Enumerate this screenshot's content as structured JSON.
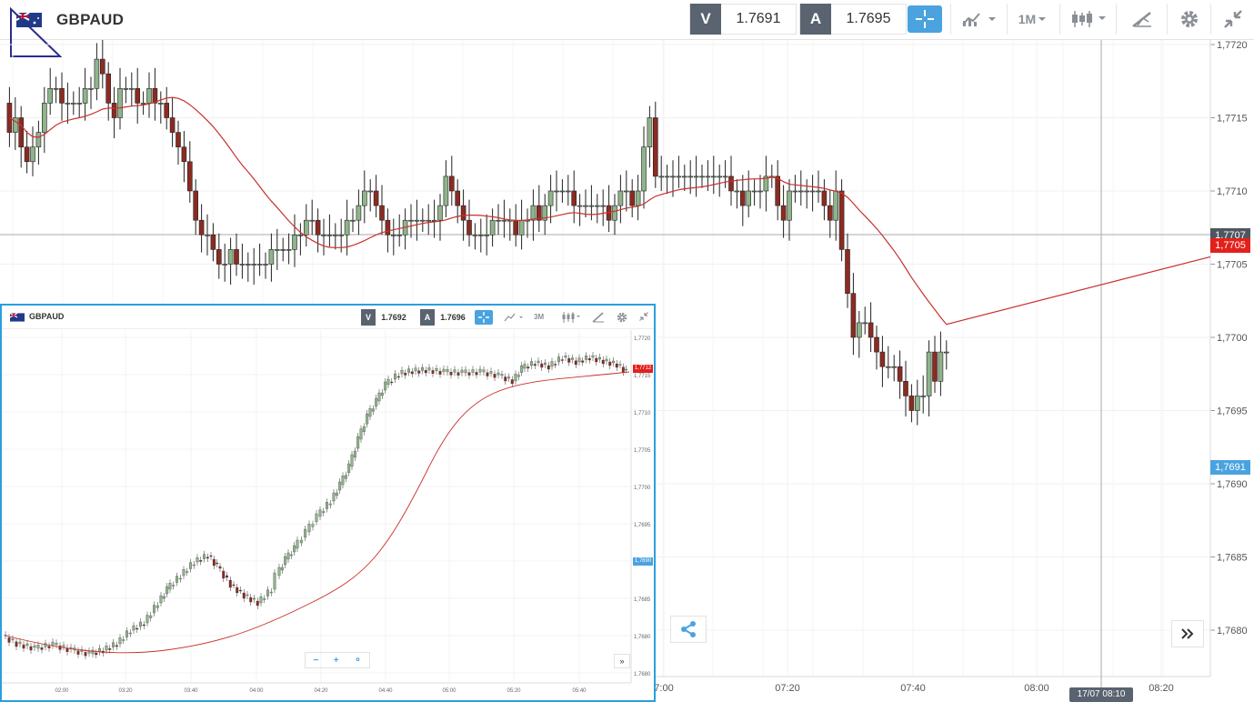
{
  "instrument": {
    "symbol": "GBPAUD"
  },
  "quote": {
    "sell_label": "V",
    "sell_price": "1.7691",
    "buy_label": "A",
    "buy_price": "1.7695"
  },
  "toolbar": {
    "timeframe": "1M",
    "icons": [
      "crosshair-icon",
      "line-chart-icon",
      "candlestick-icon",
      "drawing-tools-icon",
      "gear-icon",
      "collapse-icon"
    ]
  },
  "main_chart": {
    "y_ticks": [
      "1,7720",
      "1,7715",
      "1,7710",
      "1,7705",
      "1,7700",
      "1,7695",
      "1,7690",
      "1,7685",
      "1,7680"
    ],
    "x_ticks": [
      "7:00",
      "07:20",
      "07:40",
      "08:00",
      "08:20"
    ],
    "current_price_label": "1,7707",
    "ask_price_label": "1,7705",
    "bid_price_label": "1,7691",
    "crosshair_time": "17/07 08:10"
  },
  "inset": {
    "symbol": "GBPAUD",
    "sell_label": "V",
    "sell_price": "1.7692",
    "buy_label": "A",
    "buy_price": "1.7696",
    "timeframe": "3M",
    "y_ticks": [
      "1,7720",
      "1,7715",
      "1,7710",
      "1,7705",
      "1,7700",
      "1,7695",
      "1,7690",
      "1,7685",
      "1,7680",
      "1,7680"
    ],
    "x_ticks": [
      "02:00",
      "03:20",
      "03:40",
      "04:00",
      "04:20",
      "04:40",
      "05:00",
      "05:20",
      "05:40"
    ],
    "bid_label": "1,7690",
    "ask_label": "1,7712"
  },
  "colors": {
    "bull": "#8fb48a",
    "bear": "#8b2b22",
    "ma": "#c9302c",
    "accent": "#4aa3df",
    "tag": "#5a6370"
  }
}
